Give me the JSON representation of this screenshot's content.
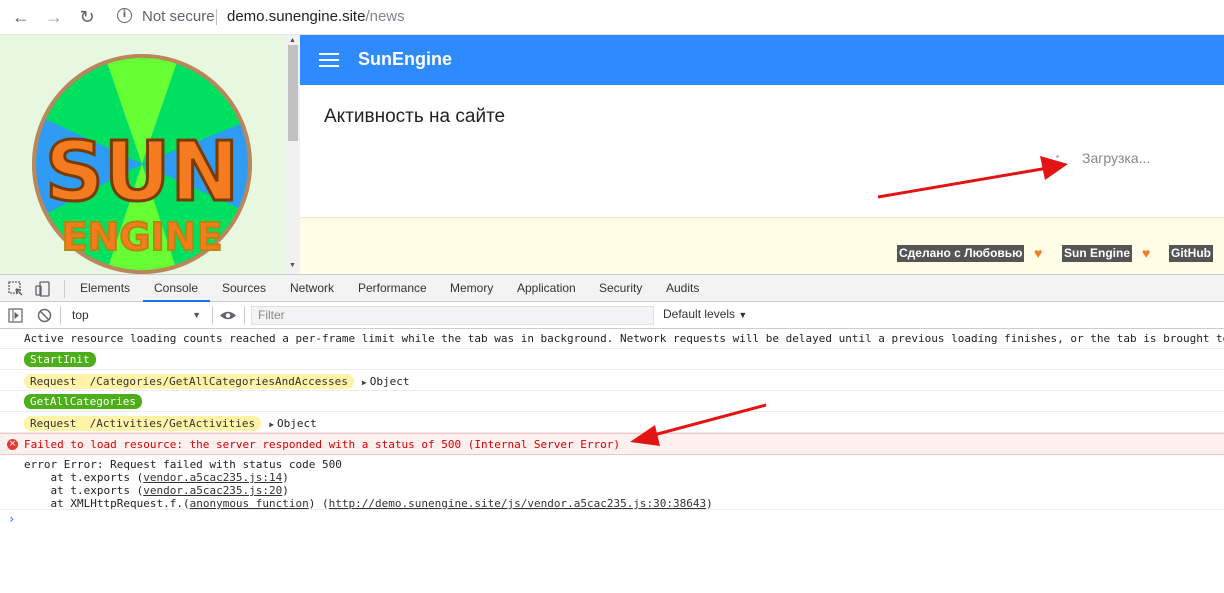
{
  "browser": {
    "security_label": "Not secure",
    "url_host": "demo.sunengine.site",
    "url_path": "/news",
    "back_icon": "arrow-left-icon",
    "forward_icon": "arrow-right-icon",
    "reload_icon": "reload-icon",
    "info_icon": "info-icon"
  },
  "logo": {
    "line1": "SUN",
    "line2": "ENGINE"
  },
  "site": {
    "brand": "SunEngine",
    "section_title": "Активность на сайте",
    "loading_text": "Загрузка...",
    "footer": {
      "made_with": "Сделано с Любовью",
      "engine_link": "Sun Engine",
      "github_link": "GitHub"
    },
    "colors": {
      "topbar": "#2e8bff",
      "footer_bg": "#fffde5",
      "heart": "#f47b20"
    }
  },
  "devtools": {
    "tabs": [
      "Elements",
      "Console",
      "Sources",
      "Network",
      "Performance",
      "Memory",
      "Application",
      "Security",
      "Audits"
    ],
    "active_tab": "Console",
    "context": "top",
    "filter_placeholder": "Filter",
    "levels": "Default levels"
  },
  "console": {
    "messages": [
      "Active resource loading counts reached a per-frame limit while the tab was in background. Network requests will be delayed until a previous loading finishes, or the tab is brought to",
      "StartInit",
      "Request",
      "/Categories/GetAllCategoriesAndAccesses",
      "Object",
      "GetAllCategories",
      "Request",
      "/Activities/GetActivities",
      "Object",
      "Failed to load resource: the server responded with a status of 500 (Internal Server Error)",
      "error Error: Request failed with status code 500"
    ],
    "stack": {
      "line1_prefix": "    at t.exports (",
      "line1_link": "vendor.a5cac235.js:14",
      "line2_prefix": "    at t.exports (",
      "line2_link": "vendor.a5cac235.js:20",
      "line3_prefix": "    at XMLHttpRequest.f.(",
      "line3_anon": "anonymous function",
      "line3_mid": ") (",
      "line3_link": "http://demo.sunengine.site/js/vendor.a5cac235.js:30:38643",
      "close": ")"
    },
    "prompt": "›"
  }
}
